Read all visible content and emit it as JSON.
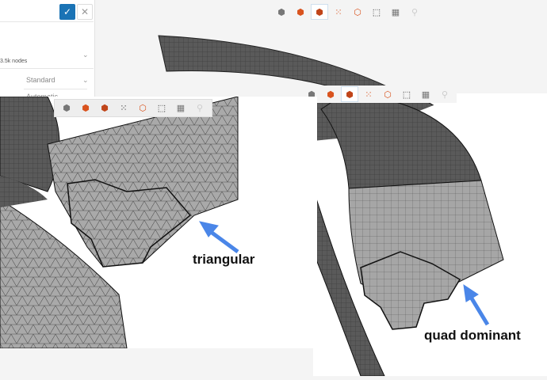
{
  "settings_panel": {
    "confirm_icon": "check-icon",
    "close_icon": "close-icon",
    "nodes_text": "3.5k nodes",
    "order_value": "Standard",
    "sizing_value": "Automatic"
  },
  "toolbar_icons": [
    "view-cube-icon",
    "solid-icon",
    "solid-edges-icon",
    "nodes-icon",
    "wireframe-icon",
    "box-select-icon",
    "parts-icon",
    "measure-icon"
  ],
  "annotations": {
    "left_label": "triangular",
    "right_label": "quad dominant",
    "arrow_color": "#4a86e8"
  }
}
